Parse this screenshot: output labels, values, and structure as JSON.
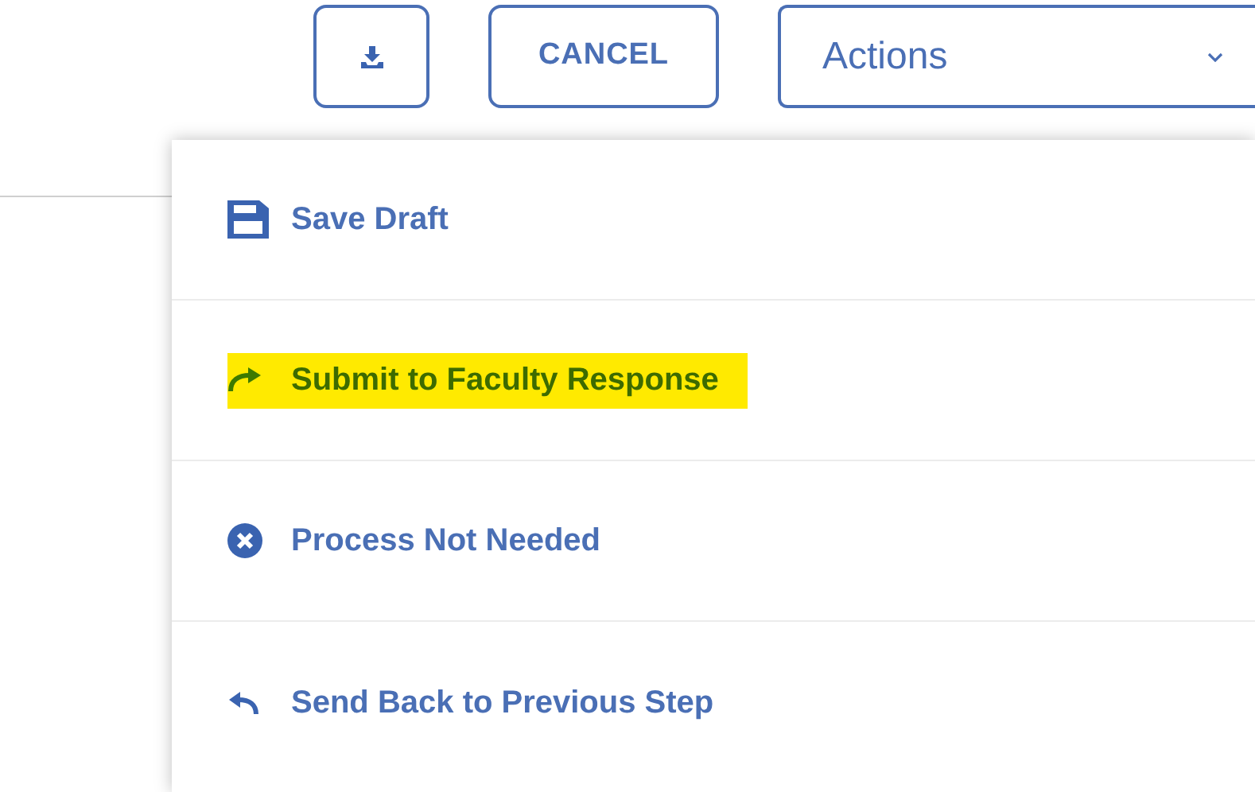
{
  "toolbar": {
    "cancel_label": "CANCEL",
    "actions_select": {
      "value": "Actions"
    }
  },
  "menu": {
    "items": [
      {
        "kind": "save",
        "label": "Save Draft",
        "highlighted": false
      },
      {
        "kind": "forward",
        "label": "Submit to Faculty Response",
        "highlighted": true
      },
      {
        "kind": "cancel",
        "label": "Process Not Needed",
        "highlighted": false
      },
      {
        "kind": "undo",
        "label": "Send Back to Previous Step",
        "highlighted": false
      }
    ]
  }
}
